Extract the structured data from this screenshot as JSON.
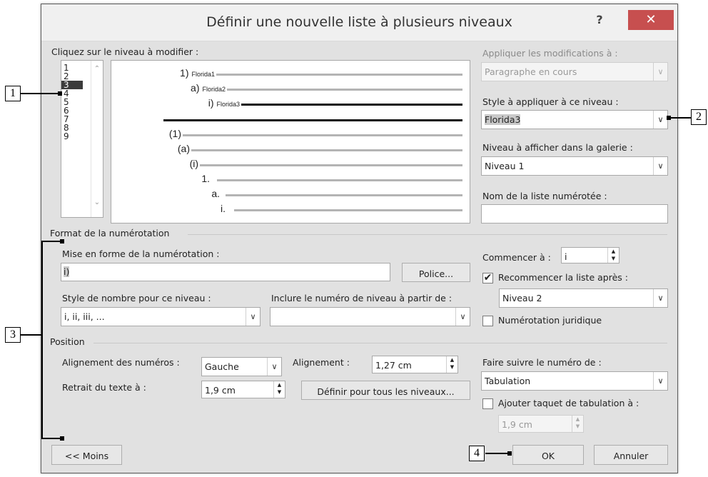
{
  "dialog": {
    "title": "Définir une nouvelle liste à plusieurs niveaux",
    "help": "?",
    "close": "✕"
  },
  "level_panel": {
    "label": "Cliquez sur le niveau à modifier :",
    "levels": [
      "1",
      "2",
      "3",
      "4",
      "5",
      "6",
      "7",
      "8",
      "9"
    ],
    "selected_level": "3"
  },
  "preview": {
    "lines": [
      {
        "num": "1)",
        "sub": "Florida1"
      },
      {
        "num": "a)",
        "sub": "Florida2"
      },
      {
        "num": "i)",
        "sub": "Florida3"
      },
      {
        "num": "",
        "sub": ""
      },
      {
        "num": "(1)",
        "sub": ""
      },
      {
        "num": "(a)",
        "sub": ""
      },
      {
        "num": "(i)",
        "sub": ""
      },
      {
        "num": "1.",
        "sub": ""
      },
      {
        "num": "a.",
        "sub": ""
      },
      {
        "num": "i.",
        "sub": ""
      }
    ]
  },
  "right_panel": {
    "apply_label": "Appliquer les modifications à :",
    "apply_value": "Paragraphe en cours",
    "style_label": "Style à appliquer à ce niveau :",
    "style_value": "Florida3",
    "gallery_label": "Niveau à afficher dans la galerie :",
    "gallery_value": "Niveau 1",
    "listname_label": "Nom de la liste numérotée :",
    "listname_value": ""
  },
  "format": {
    "section": "Format de la numérotation",
    "mise_label": "Mise en forme de la numérotation :",
    "mise_value": "i)",
    "police_button": "Police...",
    "style_label": "Style de nombre pour ce niveau :",
    "style_value": "i, ii, iii, ...",
    "include_label": "Inclure le numéro de niveau à partir de :",
    "include_value": "",
    "start_label": "Commencer à :",
    "start_value": "i",
    "restart_label": "Recommencer la liste après :",
    "restart_checked": "✔",
    "restart_value": "Niveau 2",
    "legal_label": "Numérotation juridique"
  },
  "position": {
    "section": "Position",
    "align_label": "Alignement des numéros :",
    "align_value": "Gauche",
    "alignment_label": "Alignement :",
    "alignment_value": "1,27 cm",
    "indent_label": "Retrait du texte à :",
    "indent_value": "1,9 cm",
    "set_all_button": "Définir pour tous les niveaux...",
    "follow_label": "Faire suivre le numéro de :",
    "follow_value": "Tabulation",
    "tabstop_label": "Ajouter taquet de tabulation à :",
    "tabstop_value": "1,9 cm"
  },
  "buttons": {
    "less": "<< Moins",
    "ok": "OK",
    "cancel": "Annuler"
  },
  "callouts": [
    "1",
    "2",
    "3",
    "4"
  ]
}
